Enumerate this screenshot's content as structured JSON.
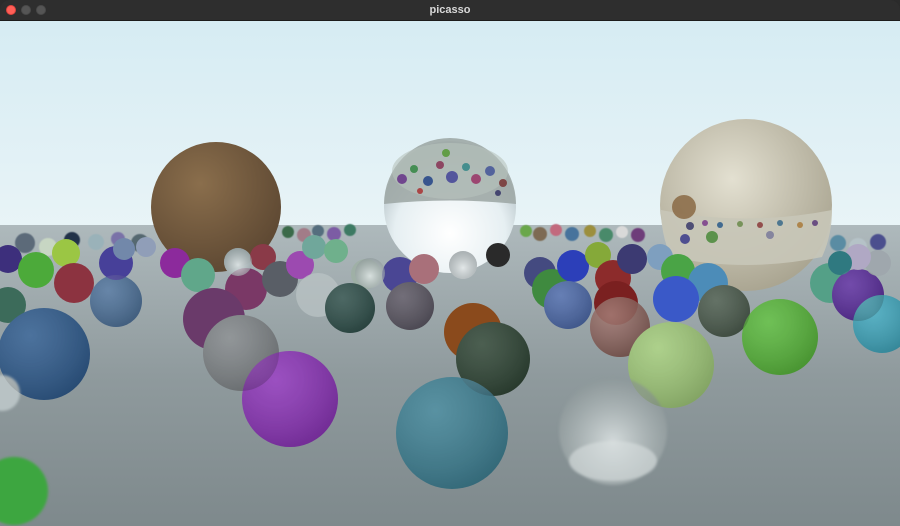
{
  "window": {
    "title": "picasso"
  },
  "viewport": {
    "description_icon": "rendered-scene"
  }
}
